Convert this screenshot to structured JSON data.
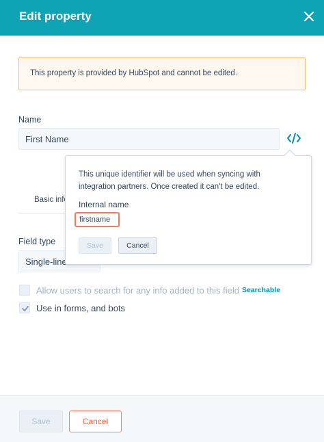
{
  "header": {
    "title": "Edit property"
  },
  "notice": {
    "text": "This property is provided by HubSpot and cannot be edited."
  },
  "name_field": {
    "label": "Name",
    "value": "First Name"
  },
  "tabs": {
    "basic_info": "Basic info"
  },
  "field_type": {
    "label": "Field type",
    "value": "Single-line"
  },
  "options": {
    "searchable_label": "Allow users to search for any info added to this field",
    "searchable_tag": "Searchable",
    "forms_label": "Use in forms, and bots"
  },
  "popover": {
    "description": "This unique identifier will be used when syncing with integration partners. Once created it can't be edited.",
    "internal_name_label": "Internal name",
    "internal_name_value": "firstname",
    "save_label": "Save",
    "cancel_label": "Cancel"
  },
  "footer": {
    "save_label": "Save",
    "cancel_label": "Cancel"
  },
  "colors": {
    "header": "#0fa3b6",
    "accent": "#0091ae",
    "cancel": "#ff5c35",
    "highlight": "#f07b5f"
  },
  "icons": {
    "close": "close-icon",
    "code": "code-icon",
    "check": "checkmark-icon"
  }
}
